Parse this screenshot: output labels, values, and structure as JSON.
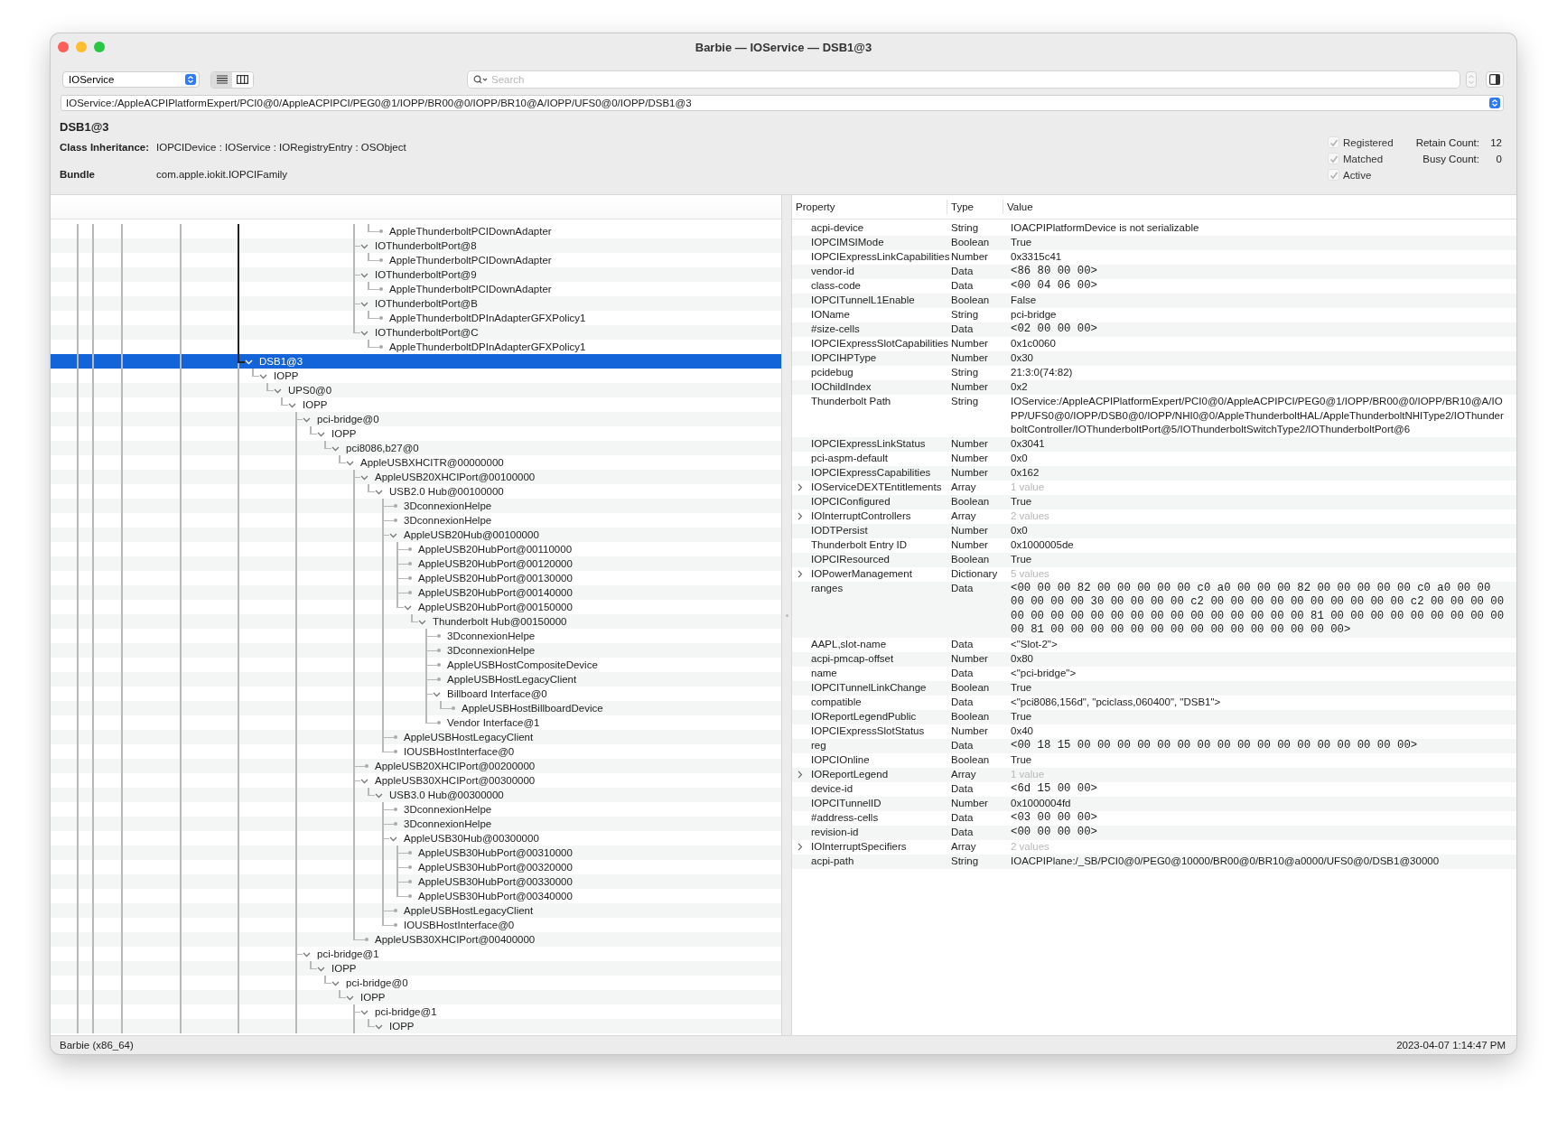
{
  "window": {
    "title": "Barbie — IOService — DSB1@3"
  },
  "toolbar": {
    "plane": "IOService",
    "views": [
      {
        "kind": "list",
        "selected": true
      },
      {
        "kind": "columns",
        "selected": false
      }
    ],
    "search": {
      "placeholder": "Search"
    }
  },
  "path": "IOService:/AppleACPIPlatformExpert/PCI0@0/AppleACPIPCI/PEG0@1/IOPP/BR00@0/IOPP/BR10@A/IOPP/UFS0@0/IOPP/DSB1@3",
  "info": {
    "name": "DSB1@3",
    "class_inheritance_label": "Class Inheritance:",
    "class_inheritance": "IOPCIDevice : IOService : IORegistryEntry : OSObject",
    "bundle_label": "Bundle",
    "bundle": "com.apple.iokit.IOPCIFamily",
    "flags": [
      {
        "label": "Registered",
        "checked": true
      },
      {
        "label": "Matched",
        "checked": true
      },
      {
        "label": "Active",
        "checked": true
      }
    ],
    "counts": [
      {
        "label": "Retain Count:",
        "value": "12"
      },
      {
        "label": "Busy Count:",
        "value": "0"
      }
    ]
  },
  "tree": {
    "scrolled_branch": {
      "orphan_rows": [
        {
          "label": "AppleThunderboltPCIDownAdapter",
          "selected": false
        }
      ],
      "nodes": [
        {
          "label": "IOThunderboltPort@8",
          "selected": false,
          "expanded": true,
          "children": [
            {
              "label": "AppleThunderboltPCIDownAdapter",
              "selected": false
            }
          ]
        },
        {
          "label": "IOThunderboltPort@9",
          "selected": false,
          "expanded": true,
          "children": [
            {
              "label": "AppleThunderboltPCIDownAdapter",
              "selected": false
            }
          ]
        },
        {
          "label": "IOThunderboltPort@B",
          "selected": false,
          "expanded": true,
          "children": [
            {
              "label": "AppleThunderboltDPInAdapterGFXPolicy1",
              "selected": false
            }
          ]
        },
        {
          "label": "IOThunderboltPort@C",
          "selected": false,
          "expanded": true,
          "children": [
            {
              "label": "AppleThunderboltDPInAdapterGFXPolicy1",
              "selected": false
            }
          ]
        }
      ]
    },
    "nodes": [
      {
        "label": "DSB1@3",
        "selected": true,
        "expanded": true,
        "has_more_below": true,
        "children": [
          {
            "label": "IOPP",
            "selected": false,
            "expanded": true,
            "children": [
              {
                "label": "UPS0@0",
                "selected": false,
                "expanded": true,
                "children": [
                  {
                    "label": "IOPP",
                    "selected": false,
                    "expanded": true,
                    "children": [
                      {
                        "label": "pci-bridge@0",
                        "selected": false,
                        "expanded": true,
                        "children": [
                          {
                            "label": "IOPP",
                            "selected": false,
                            "expanded": true,
                            "children": [
                              {
                                "label": "pci8086,b27@0",
                                "selected": false,
                                "expanded": true,
                                "children": [
                                  {
                                    "label": "AppleUSBXHCITR@00000000",
                                    "selected": false,
                                    "expanded": true,
                                    "children": [
                                      {
                                        "label": "AppleUSB20XHCIPort@00100000",
                                        "selected": false,
                                        "expanded": true,
                                        "children": [
                                          {
                                            "label": "USB2.0 Hub@00100000",
                                            "selected": false,
                                            "expanded": true,
                                            "children": [
                                              {
                                                "label": "3DconnexionHelpe",
                                                "selected": false
                                              },
                                              {
                                                "label": "3DconnexionHelpe",
                                                "selected": false
                                              },
                                              {
                                                "label": "AppleUSB20Hub@00100000",
                                                "selected": false,
                                                "expanded": true,
                                                "children": [
                                                  {
                                                    "label": "AppleUSB20HubPort@00110000",
                                                    "selected": false
                                                  },
                                                  {
                                                    "label": "AppleUSB20HubPort@00120000",
                                                    "selected": false
                                                  },
                                                  {
                                                    "label": "AppleUSB20HubPort@00130000",
                                                    "selected": false
                                                  },
                                                  {
                                                    "label": "AppleUSB20HubPort@00140000",
                                                    "selected": false
                                                  },
                                                  {
                                                    "label": "AppleUSB20HubPort@00150000",
                                                    "selected": false,
                                                    "expanded": true,
                                                    "children": [
                                                      {
                                                        "label": "Thunderbolt Hub@00150000",
                                                        "selected": false,
                                                        "expanded": true,
                                                        "children": [
                                                          {
                                                            "label": "3DconnexionHelpe",
                                                            "selected": false
                                                          },
                                                          {
                                                            "label": "3DconnexionHelpe",
                                                            "selected": false
                                                          },
                                                          {
                                                            "label": "AppleUSBHostCompositeDevice",
                                                            "selected": false
                                                          },
                                                          {
                                                            "label": "AppleUSBHostLegacyClient",
                                                            "selected": false
                                                          },
                                                          {
                                                            "label": "Billboard Interface@0",
                                                            "selected": false,
                                                            "expanded": true,
                                                            "children": [
                                                              {
                                                                "label": "AppleUSBHostBillboardDevice",
                                                                "selected": false
                                                              }
                                                            ]
                                                          },
                                                          {
                                                            "label": "Vendor Interface@1",
                                                            "selected": false
                                                          }
                                                        ]
                                                      }
                                                    ]
                                                  }
                                                ]
                                              },
                                              {
                                                "label": "AppleUSBHostLegacyClient",
                                                "selected": false
                                              },
                                              {
                                                "label": "IOUSBHostInterface@0",
                                                "selected": false
                                              }
                                            ]
                                          }
                                        ]
                                      },
                                      {
                                        "label": "AppleUSB20XHCIPort@00200000",
                                        "selected": false
                                      },
                                      {
                                        "label": "AppleUSB30XHCIPort@00300000",
                                        "selected": false,
                                        "expanded": true,
                                        "children": [
                                          {
                                            "label": "USB3.0 Hub@00300000",
                                            "selected": false,
                                            "expanded": true,
                                            "children": [
                                              {
                                                "label": "3DconnexionHelpe",
                                                "selected": false
                                              },
                                              {
                                                "label": "3DconnexionHelpe",
                                                "selected": false
                                              },
                                              {
                                                "label": "AppleUSB30Hub@00300000",
                                                "selected": false,
                                                "expanded": true,
                                                "children": [
                                                  {
                                                    "label": "AppleUSB30HubPort@00310000",
                                                    "selected": false
                                                  },
                                                  {
                                                    "label": "AppleUSB30HubPort@00320000",
                                                    "selected": false
                                                  },
                                                  {
                                                    "label": "AppleUSB30HubPort@00330000",
                                                    "selected": false
                                                  },
                                                  {
                                                    "label": "AppleUSB30HubPort@00340000",
                                                    "selected": false
                                                  }
                                                ]
                                              },
                                              {
                                                "label": "AppleUSBHostLegacyClient",
                                                "selected": false
                                              },
                                              {
                                                "label": "IOUSBHostInterface@0",
                                                "selected": false
                                              }
                                            ]
                                          }
                                        ]
                                      },
                                      {
                                        "label": "AppleUSB30XHCIPort@00400000",
                                        "selected": false
                                      }
                                    ]
                                  }
                                ]
                              }
                            ]
                          }
                        ]
                      },
                      {
                        "label": "pci-bridge@1",
                        "selected": false,
                        "expanded": true,
                        "has_more_below": true,
                        "children": [
                          {
                            "label": "IOPP",
                            "selected": false,
                            "expanded": true,
                            "children": [
                              {
                                "label": "pci-bridge@0",
                                "selected": false,
                                "expanded": true,
                                "children": [
                                  {
                                    "label": "IOPP",
                                    "selected": false,
                                    "expanded": true,
                                    "children": [
                                      {
                                        "label": "pci-bridge@1",
                                        "selected": false,
                                        "expanded": true,
                                        "has_more_below": true,
                                        "children": [
                                          {
                                            "label": "IOPP",
                                            "selected": false,
                                            "expanded": true
                                          }
                                        ]
                                      }
                                    ]
                                  }
                                ]
                              }
                            ]
                          }
                        ]
                      }
                    ]
                  }
                ]
              }
            ]
          }
        ]
      }
    ]
  },
  "properties": {
    "columns": [
      "Property",
      "Type",
      "Value"
    ],
    "rows": [
      {
        "name": "acpi-device",
        "type": "String",
        "value": "IOACPIPlatformDevice is not serializable",
        "kind": "text"
      },
      {
        "name": "IOPCIMSIMode",
        "type": "Boolean",
        "value": "True",
        "kind": "text"
      },
      {
        "name": "IOPCIExpressLinkCapabilities",
        "type": "Number",
        "value": "0x3315c41",
        "kind": "text"
      },
      {
        "name": "vendor-id",
        "type": "Data",
        "value": "<86 80 00 00>",
        "kind": "hex"
      },
      {
        "name": "class-code",
        "type": "Data",
        "value": "<00 04 06 00>",
        "kind": "hex"
      },
      {
        "name": "IOPCITunnelL1Enable",
        "type": "Boolean",
        "value": "False",
        "kind": "text"
      },
      {
        "name": "IOName",
        "type": "String",
        "value": "pci-bridge",
        "kind": "text"
      },
      {
        "name": "#size-cells",
        "type": "Data",
        "value": "<02 00 00 00>",
        "kind": "hex"
      },
      {
        "name": "IOPCIExpressSlotCapabilities",
        "type": "Number",
        "value": "0x1c0060",
        "kind": "text"
      },
      {
        "name": "IOPCIHPType",
        "type": "Number",
        "value": "0x30",
        "kind": "text"
      },
      {
        "name": "pcidebug",
        "type": "String",
        "value": "21:3:0(74:82)",
        "kind": "text"
      },
      {
        "name": "IOChildIndex",
        "type": "Number",
        "value": "0x2",
        "kind": "text"
      },
      {
        "name": "Thunderbolt Path",
        "type": "String",
        "value": "IOService:/AppleACPIPlatformExpert/PCI0@0/AppleACPIPCI/PEG0@1/IOPP/BR00@0/IOPP/BR10@A/IOPP/UFS0@0/IOPP/DSB0@0/IOPP/NHI0@0/AppleThunderboltHAL/AppleThunderboltNHIType2/IOThunderboltController/IOThunderboltPort@5/IOThunderboltSwitchType2/IOThunderboltPort@6",
        "kind": "text"
      },
      {
        "name": "IOPCIExpressLinkStatus",
        "type": "Number",
        "value": "0x3041",
        "kind": "text"
      },
      {
        "name": "pci-aspm-default",
        "type": "Number",
        "value": "0x0",
        "kind": "text"
      },
      {
        "name": "IOPCIExpressCapabilities",
        "type": "Number",
        "value": "0x162",
        "kind": "text"
      },
      {
        "name": "IOServiceDEXTEntitlements",
        "type": "Array",
        "value": "1 value",
        "kind": "collection",
        "expanded": false
      },
      {
        "name": "IOPCIConfigured",
        "type": "Boolean",
        "value": "True",
        "kind": "text"
      },
      {
        "name": "IOInterruptControllers",
        "type": "Array",
        "value": "2 values",
        "kind": "collection",
        "expanded": false
      },
      {
        "name": "IODTPersist",
        "type": "Number",
        "value": "0x0",
        "kind": "text"
      },
      {
        "name": "Thunderbolt Entry ID",
        "type": "Number",
        "value": "0x1000005de",
        "kind": "text"
      },
      {
        "name": "IOPCIResourced",
        "type": "Boolean",
        "value": "True",
        "kind": "text"
      },
      {
        "name": "IOPowerManagement",
        "type": "Dictionary",
        "value": "5 values",
        "kind": "collection",
        "expanded": false
      },
      {
        "name": "ranges",
        "type": "Data",
        "value": "<00 00 00 82 00 00 00 00 00 c0 a0 00 00 00 82 00 00 00 00 00 c0 a0 00 00 00 00 00 00 30 00 00 00 00 c2 00 00 00 00 00 00 00 00 00 00 c2 00 00 00 00 00 00 00 00 00 00 00 00 00 00 00 00 00 00 00 81 00 00 00 00 00 00 00 00 00 00 81 00 00 00 00 00 00 00 00 00 00 00 00 00 00 00>",
        "kind": "hex"
      },
      {
        "name": "AAPL,slot-name",
        "type": "Data",
        "value": "<\"Slot-2\">",
        "kind": "text"
      },
      {
        "name": "acpi-pmcap-offset",
        "type": "Number",
        "value": "0x80",
        "kind": "text"
      },
      {
        "name": "name",
        "type": "Data",
        "value": "<\"pci-bridge\">",
        "kind": "text"
      },
      {
        "name": "IOPCITunnelLinkChange",
        "type": "Boolean",
        "value": "True",
        "kind": "text"
      },
      {
        "name": "compatible",
        "type": "Data",
        "value": "<\"pci8086,156d\", \"pciclass,060400\", \"DSB1\">",
        "kind": "text"
      },
      {
        "name": "IOReportLegendPublic",
        "type": "Boolean",
        "value": "True",
        "kind": "text"
      },
      {
        "name": "IOPCIExpressSlotStatus",
        "type": "Number",
        "value": "0x40",
        "kind": "text"
      },
      {
        "name": "reg",
        "type": "Data",
        "value": "<00 18 15 00 00 00 00 00 00 00 00 00 00 00 00 00 00 00 00 00>",
        "kind": "hex"
      },
      {
        "name": "IOPCIOnline",
        "type": "Boolean",
        "value": "True",
        "kind": "text"
      },
      {
        "name": "IOReportLegend",
        "type": "Array",
        "value": "1 value",
        "kind": "collection",
        "expanded": false
      },
      {
        "name": "device-id",
        "type": "Data",
        "value": "<6d 15 00 00>",
        "kind": "hex"
      },
      {
        "name": "IOPCITunnelID",
        "type": "Number",
        "value": "0x1000004fd",
        "kind": "text"
      },
      {
        "name": "#address-cells",
        "type": "Data",
        "value": "<03 00 00 00>",
        "kind": "hex"
      },
      {
        "name": "revision-id",
        "type": "Data",
        "value": "<00 00 00 00>",
        "kind": "hex"
      },
      {
        "name": "IOInterruptSpecifiers",
        "type": "Array",
        "value": "2 values",
        "kind": "collection",
        "expanded": false
      },
      {
        "name": "acpi-path",
        "type": "String",
        "value": "IOACPIPlane:/_SB/PCI0@0/PEG0@10000/BR00@0/BR10@a0000/UFS0@0/DSB1@30000",
        "kind": "text"
      }
    ]
  },
  "status_bar": {
    "left": "Barbie (x86_64)",
    "right": "2023-04-07 1:14:47 PM"
  }
}
